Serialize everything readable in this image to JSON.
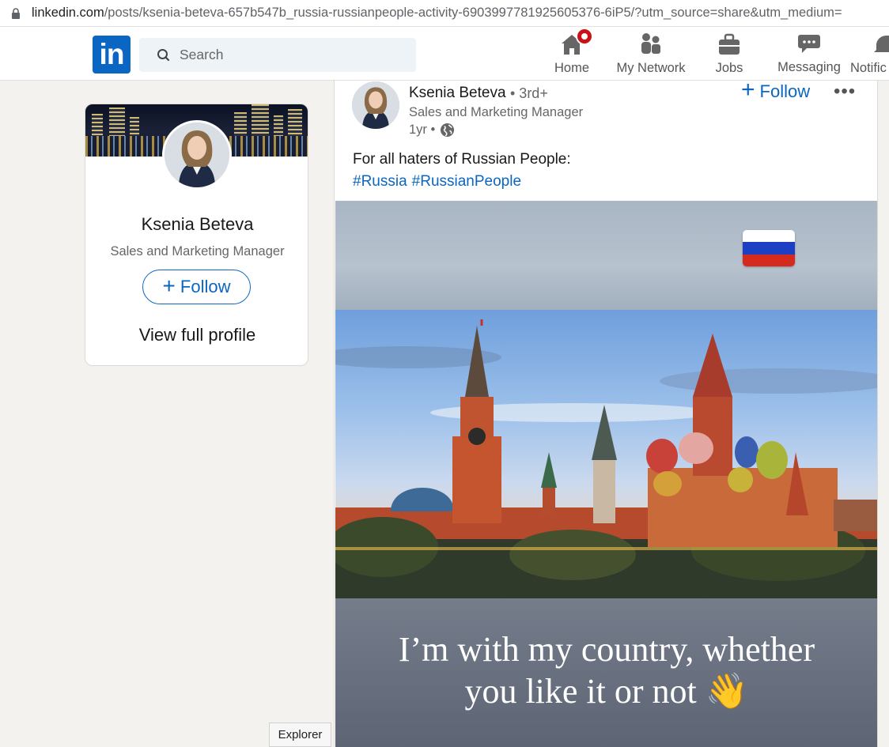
{
  "browser": {
    "url_host": "linkedin.com",
    "url_path": "/posts/ksenia-beteva-657b547b_russia-russianpeople-activity-6903997781925605376-6iP5/?utm_source=share&utm_medium=",
    "lock_icon": "lock-icon"
  },
  "nav": {
    "logo": "in",
    "search_placeholder": "Search",
    "items": [
      {
        "label": "Home",
        "icon": "home-icon",
        "badge": true
      },
      {
        "label": "My Network",
        "icon": "people-icon"
      },
      {
        "label": "Jobs",
        "icon": "briefcase-icon"
      },
      {
        "label": "Messaging",
        "icon": "chat-icon"
      },
      {
        "label": "Notific",
        "icon": "bell-icon"
      }
    ]
  },
  "profile_card": {
    "name": "Ksenia Beteva",
    "title": "Sales and Marketing Manager",
    "follow_label": "Follow",
    "view_profile_label": "View full profile"
  },
  "post": {
    "author_name": "Ksenia Beteva",
    "degree": "• 3rd+",
    "author_title": "Sales and Marketing Manager",
    "time": "1yr •",
    "follow_label": "Follow",
    "more_label": "•••",
    "text": "For all haters of Russian People:",
    "hashtags": [
      "#Russia",
      "#RussianPeople"
    ],
    "image": {
      "caption_line1": "I’m with my country, whether",
      "caption_line2": "you like it or not 👋",
      "flag_colors": [
        "#ffffff",
        "#1c3fc4",
        "#d52b1e"
      ]
    }
  },
  "tooltip": {
    "text": "Explorer"
  },
  "colors": {
    "brand": "#0a66c2",
    "badge": "#cc1016",
    "background": "#f3f2ef"
  }
}
